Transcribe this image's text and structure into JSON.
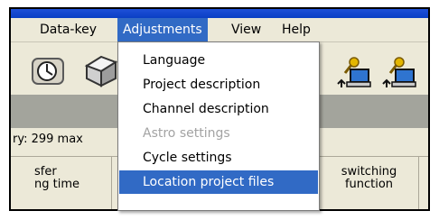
{
  "menubar": {
    "items": [
      {
        "label": "Data-key"
      },
      {
        "label": "Adjustments"
      },
      {
        "label": "View"
      },
      {
        "label": "Help"
      }
    ]
  },
  "dropdown": {
    "items": [
      {
        "label": "Language",
        "enabled": true
      },
      {
        "label": "Project description",
        "enabled": true
      },
      {
        "label": "Channel description",
        "enabled": true
      },
      {
        "label": "Astro settings",
        "enabled": false
      },
      {
        "label": "Cycle settings",
        "enabled": true
      },
      {
        "label": "Location project files",
        "enabled": true,
        "selected": true
      }
    ]
  },
  "status": {
    "text": "ry: 299 max"
  },
  "table": {
    "left_header_line1": "sfer",
    "left_header_line2": "ng time",
    "right_header_line1": "switching",
    "right_header_line2": "function"
  },
  "icons": [
    "clock-icon",
    "box-icon",
    "key-computer-icon",
    "key-computer-icon"
  ],
  "colors": {
    "selection": "#316ac5",
    "menu_bg": "#ece9d8",
    "titlebar": "#0a3fc4",
    "strip": "#a3a49c",
    "disabled": "#a3a3a3"
  }
}
